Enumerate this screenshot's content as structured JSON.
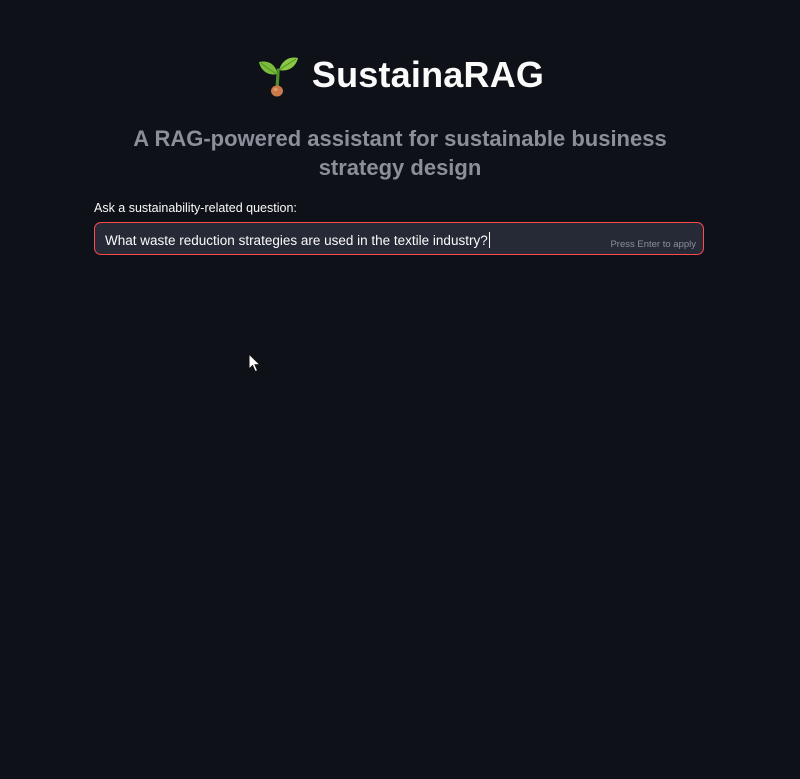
{
  "header": {
    "icon": "sprout-icon",
    "title": "SustainaRAG",
    "subtitle": "A RAG-powered assistant for sustainable business strategy design"
  },
  "query": {
    "label": "Ask a sustainability-related question:",
    "value": "What waste reduction strategies are used in the textile industry?",
    "hint": "Press Enter to apply"
  },
  "colors": {
    "background": "#0e1117",
    "input_background": "#262a36",
    "focus_border": "#ff4b4b",
    "title": "#fafafa",
    "subtitle": "#8b8f99"
  }
}
